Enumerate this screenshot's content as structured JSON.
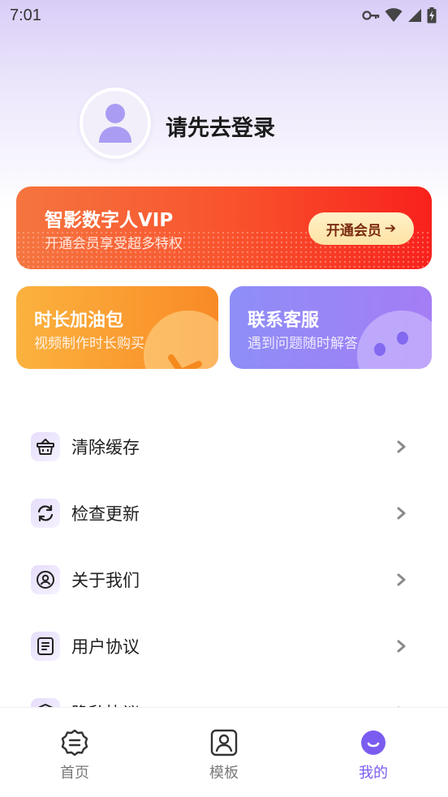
{
  "status_bar": {
    "time": "7:01"
  },
  "profile": {
    "login_prompt": "请先去登录"
  },
  "vip_banner": {
    "title": "智影数字人VIP",
    "subtitle": "开通会员享受超多特权",
    "button_label": "开通会员",
    "button_arrow": "➔"
  },
  "cards": {
    "time_pack": {
      "title": "时长加油包",
      "subtitle": "视频制作时长购买"
    },
    "customer_service": {
      "title": "联系客服",
      "subtitle": "遇到问题随时解答"
    }
  },
  "menu": {
    "items": [
      {
        "label": "清除缓存",
        "icon": "basket-icon"
      },
      {
        "label": "检查更新",
        "icon": "refresh-icon"
      },
      {
        "label": "关于我们",
        "icon": "user-circle-icon"
      },
      {
        "label": "用户协议",
        "icon": "document-icon"
      },
      {
        "label": "隐私协议",
        "icon": "shield-icon"
      }
    ]
  },
  "bottom_nav": {
    "items": [
      {
        "label": "首页",
        "icon": "home-badge-icon",
        "active": false
      },
      {
        "label": "模板",
        "icon": "template-icon",
        "active": false
      },
      {
        "label": "我的",
        "icon": "profile-smile-icon",
        "active": true
      }
    ]
  },
  "colors": {
    "accent": "#7b5cf0",
    "vip_gradient_start": "#f5753f",
    "vip_gradient_end": "#f8211c",
    "time_card": "#f98a26",
    "service_card": "#a47df5"
  }
}
